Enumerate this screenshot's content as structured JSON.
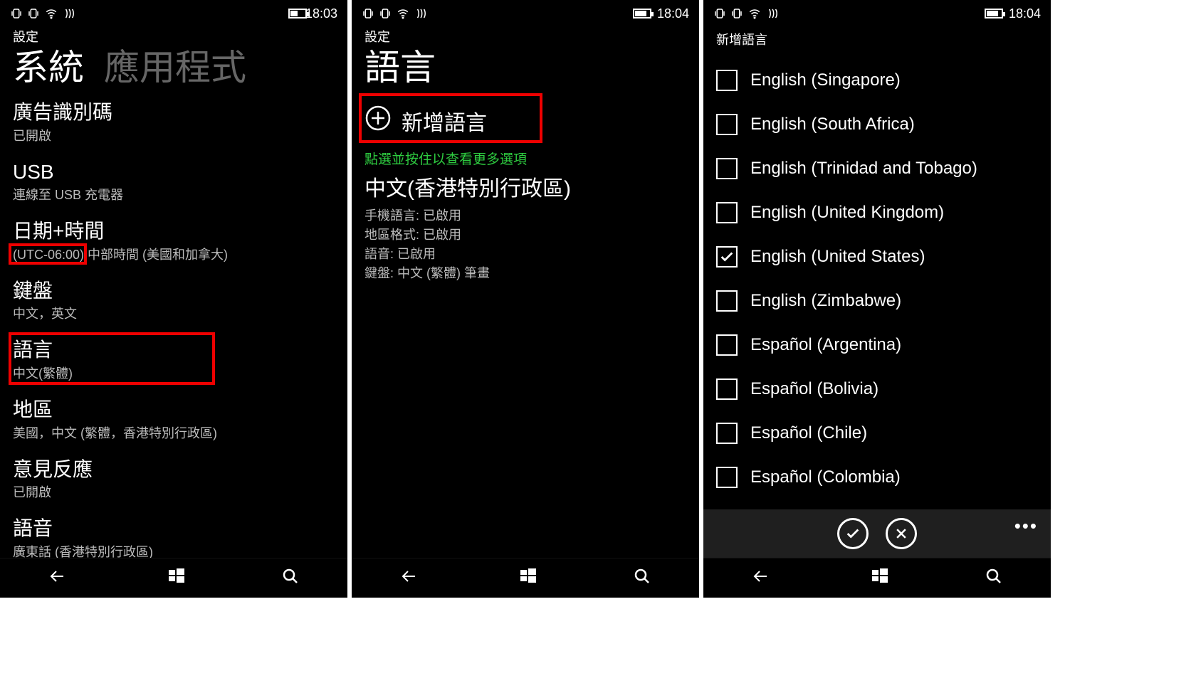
{
  "screens": [
    {
      "status": {
        "time": "18:03",
        "charging": true
      },
      "header": "設定",
      "pivots": [
        {
          "label": "系統",
          "active": true
        },
        {
          "label": "應用程式",
          "active": false
        }
      ],
      "items": [
        {
          "title": "廣告識別碼",
          "sub": "已開啟"
        },
        {
          "title": "USB",
          "sub": "連線至 USB 充電器"
        },
        {
          "title": "日期+時間",
          "sub": "(UTC-06:00) 中部時間 (美國和加拿大)"
        },
        {
          "title": "鍵盤",
          "sub": "中文，英文"
        },
        {
          "title": "語言",
          "sub": "中文(繁體)"
        },
        {
          "title": "地區",
          "sub": "美國，中文 (繁體，香港特別行政區)"
        },
        {
          "title": "意見反應",
          "sub": "已開啟"
        },
        {
          "title": "語音",
          "sub": "廣東話 (香港特別行政區)"
        }
      ]
    },
    {
      "status": {
        "time": "18:04",
        "charging": false
      },
      "header": "設定",
      "title": "語言",
      "add_label": "新增語言",
      "hint": "點選並按住以查看更多選項",
      "current": {
        "name": "中文(香港特別行政區)",
        "lines": [
          {
            "k": "手機語言:",
            "v": "已啟用"
          },
          {
            "k": "地區格式:",
            "v": "已啟用"
          },
          {
            "k": "語音:",
            "v": "已啟用"
          },
          {
            "k": "鍵盤:",
            "v": "中文 (繁體) 筆畫"
          }
        ]
      }
    },
    {
      "status": {
        "time": "18:04",
        "charging": false
      },
      "title": "新增語言",
      "langs": [
        {
          "label": "English (Singapore)",
          "checked": false
        },
        {
          "label": "English (South Africa)",
          "checked": false
        },
        {
          "label": "English (Trinidad and Tobago)",
          "checked": false
        },
        {
          "label": "English (United Kingdom)",
          "checked": false
        },
        {
          "label": "English (United States)",
          "checked": true
        },
        {
          "label": "English (Zimbabwe)",
          "checked": false
        },
        {
          "label": "Español (Argentina)",
          "checked": false
        },
        {
          "label": "Español (Bolivia)",
          "checked": false
        },
        {
          "label": "Español (Chile)",
          "checked": false
        },
        {
          "label": "Español (Colombia)",
          "checked": false
        }
      ]
    }
  ]
}
